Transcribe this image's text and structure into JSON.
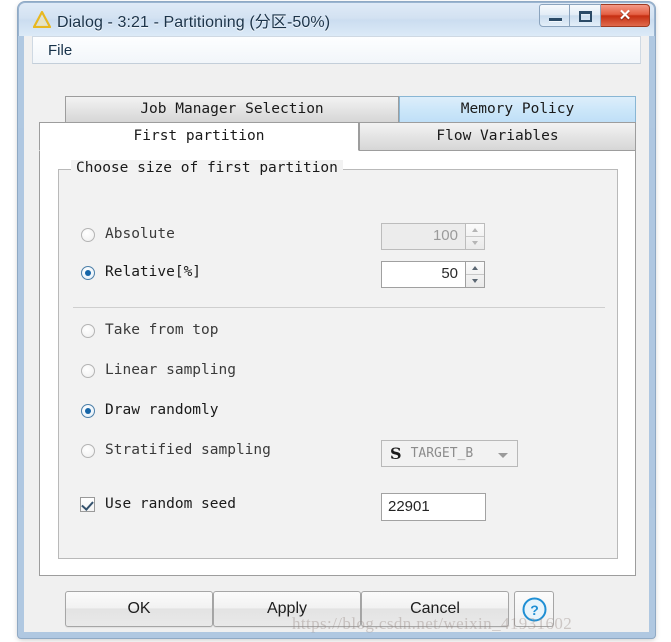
{
  "window": {
    "title": "Dialog - 3:21 - Partitioning (分区-50%)",
    "icon": "triangle-warning-icon",
    "controls": {
      "minimize": "–",
      "maximize": "❐",
      "close": "✕"
    }
  },
  "menubar": {
    "items": [
      {
        "label": "File"
      }
    ]
  },
  "tabs": {
    "row1": [
      {
        "label": "Job Manager Selection",
        "state": "inactive"
      },
      {
        "label": "Memory Policy",
        "state": "highlight"
      }
    ],
    "row2": [
      {
        "label": "First partition",
        "state": "active"
      },
      {
        "label": "Flow Variables",
        "state": "inactive"
      }
    ]
  },
  "panel": {
    "group_title": "Choose size of first partition",
    "size_options": [
      {
        "label": "Absolute",
        "selected": false,
        "enabled": false,
        "value": "100"
      },
      {
        "label": "Relative[%]",
        "selected": true,
        "enabled": true,
        "value": "50"
      }
    ],
    "sampling_options": [
      {
        "label": "Take from top",
        "selected": false
      },
      {
        "label": "Linear sampling",
        "selected": false
      },
      {
        "label": "Draw randomly",
        "selected": true
      },
      {
        "label": "Stratified sampling",
        "selected": false
      }
    ],
    "stratified_column": {
      "type_icon": "S",
      "value": "TARGET_B",
      "arrow": "chevron-down-icon"
    },
    "random_seed": {
      "label": "Use random seed",
      "checked": true,
      "value": "22901"
    }
  },
  "buttons": {
    "ok": "OK",
    "apply": "Apply",
    "cancel": "Cancel",
    "help": "?"
  },
  "watermark": "https://blog.csdn.net/weixin_41931602",
  "colors": {
    "accent": "#1565a8",
    "title_bar": "#d3e2f2",
    "close_button": "#c62f12",
    "tab_highlight": "#cbe6f9"
  }
}
